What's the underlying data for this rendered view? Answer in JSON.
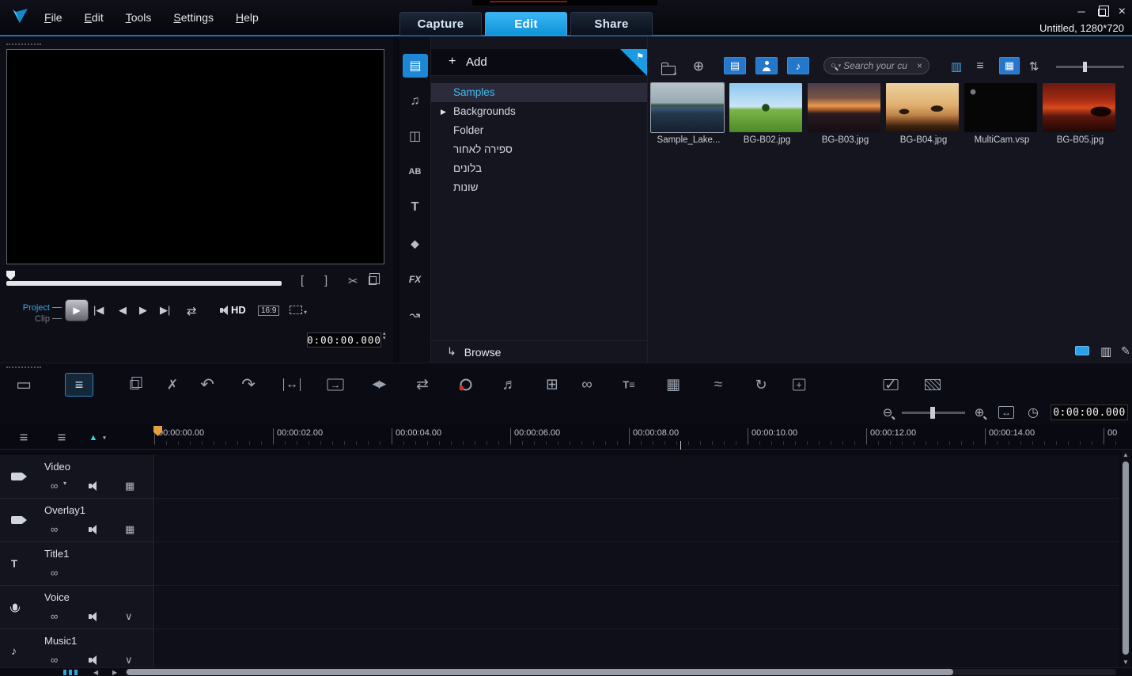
{
  "window": {
    "title": "Untitled, 1280*720"
  },
  "menu": {
    "items": [
      "File",
      "Edit",
      "Tools",
      "Settings",
      "Help"
    ]
  },
  "tabs": {
    "capture": "Capture",
    "edit": "Edit",
    "share": "Share",
    "active": "Edit"
  },
  "preview": {
    "project_label": "Project",
    "clip_label": "Clip",
    "hd_label": "HD",
    "aspect_label": "16:9",
    "timecode": "0:00:00.000"
  },
  "library": {
    "add_label": "Add",
    "items": [
      {
        "label": "Samples",
        "selected": true
      },
      {
        "label": "Backgrounds",
        "expandable": true
      },
      {
        "label": "Folder"
      },
      {
        "label": "ספירה לאחור"
      },
      {
        "label": "בלונים"
      },
      {
        "label": "שונות"
      }
    ],
    "browse_label": "Browse"
  },
  "gallery": {
    "search_placeholder": "Search your cu",
    "items": [
      {
        "name": "Sample_Lake...",
        "selected": true
      },
      {
        "name": "BG-B02.jpg"
      },
      {
        "name": "BG-B03.jpg"
      },
      {
        "name": "BG-B04.jpg"
      },
      {
        "name": "MultiCam.vsp"
      },
      {
        "name": "BG-B05.jpg"
      }
    ]
  },
  "zoombar": {
    "timecode": "0:00:00.000"
  },
  "timeline": {
    "ruler": [
      "00:00:00.00",
      "00:00:02.00",
      "00:00:04.00",
      "00:00:06.00",
      "00:00:08.00",
      "00:00:10.00",
      "00:00:12.00",
      "00:00:14.00",
      "00"
    ],
    "tracks": [
      {
        "name": "Video"
      },
      {
        "name": "Overlay1"
      },
      {
        "name": "Title1"
      },
      {
        "name": "Voice"
      },
      {
        "name": "Music1"
      }
    ]
  },
  "colors": {
    "accent": "#1aa3e8",
    "selection_text": "#41bdf0",
    "playhead": "#e0a23a"
  },
  "icons": {
    "minimize": "─",
    "close": "×",
    "plus": "+",
    "flag": "⚑",
    "expander": "▶",
    "lib_media": "▤",
    "lib_music": "♫",
    "lib_transition": "◫",
    "lib_ab": "AB",
    "lib_title": "T",
    "lib_overlay": "◆",
    "lib_fx": "FX",
    "lib_motion": "↝",
    "browse": "↳",
    "globe": "⊕",
    "filter_media": "▤",
    "filter_music": "♪",
    "view_strip": "▥",
    "view_list": "≡",
    "view_thumb": "▦",
    "sort": "⇅",
    "dropdown": "▾",
    "clear": "×",
    "panel_columns": "▥",
    "pencil": "✎",
    "home": "|◀",
    "frame_back": "◀",
    "frame_fwd": "▶",
    "end": "▶|",
    "loop": "⇄",
    "play": "▶",
    "mark_in": "[",
    "mark_out": "]",
    "scissors": "✂",
    "spin_up": "▴",
    "spin_down": "▾",
    "storyboard": "▭",
    "timeline_view": "≡",
    "tools": "✗",
    "undo": "↶",
    "redo": "↷",
    "fit": "↔",
    "insert": "→",
    "split": "◀|▶",
    "swap": "⇄",
    "mixer": "♬",
    "multicam": "⊞",
    "blend": "∞",
    "subtitle": "T≡",
    "table": "▦",
    "motion": "≈",
    "refresh": "↻",
    "crosshair": "+",
    "check": "✓",
    "zoom_out": "⊖",
    "zoom_in": "⊕",
    "clock": "◷",
    "track_list": "≡",
    "track_manager": "≡",
    "marker_up": "▲",
    "link": "∞",
    "grid": "▦",
    "collapse": "∨",
    "note": "♪",
    "title_t": "T",
    "left": "◀",
    "right": "▶",
    "up": "▲",
    "down": "▼"
  }
}
